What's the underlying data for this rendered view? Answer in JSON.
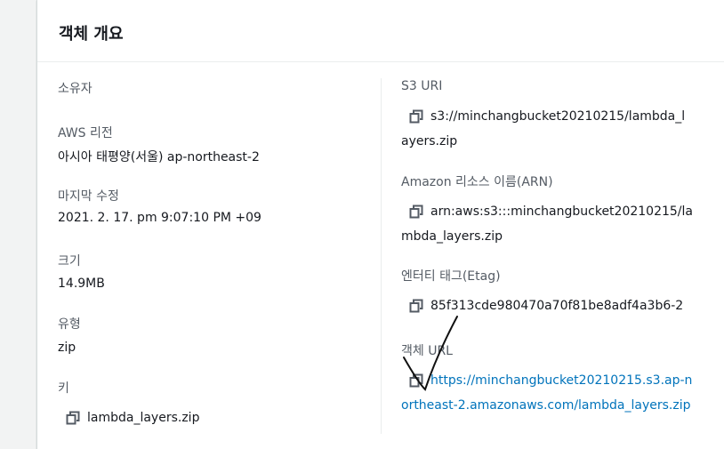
{
  "panel": {
    "title": "객체 개요"
  },
  "left": {
    "owner": {
      "label": "소유자",
      "value": ""
    },
    "region": {
      "label": "AWS 리전",
      "value": "아시아 태평양(서울) ap-northeast-2"
    },
    "modified": {
      "label": "마지막 수정",
      "value": "2021. 2. 17. pm 9:07:10 PM +09"
    },
    "size": {
      "label": "크기",
      "value": "14.9MB"
    },
    "type": {
      "label": "유형",
      "value": "zip"
    },
    "key": {
      "label": "키",
      "value": "lambda_layers.zip"
    }
  },
  "right": {
    "s3_uri": {
      "label": "S3 URI",
      "lines": [
        "s3://minchangbucket20210215/lambda_l",
        "ayers.zip"
      ]
    },
    "arn": {
      "label": "Amazon 리소스 이름(ARN)",
      "lines": [
        "arn:aws:s3:::minchangbucket20210215/la",
        "mbda_layers.zip"
      ]
    },
    "etag": {
      "label": "엔터티 태그(Etag)",
      "value": "85f313cde980470a70f81be8adf4a3b6-2"
    },
    "object_url": {
      "label": "객체 URL",
      "lines": [
        "https://minchangbucket20210215.s3.ap-n",
        "ortheast-2.amazonaws.com/lambda_layers.zip"
      ]
    }
  },
  "icons": {
    "copy": "copy-icon"
  },
  "colors": {
    "link": "#0073bb",
    "label": "#545b64",
    "text": "#16191f",
    "background": "#f2f3f3"
  }
}
